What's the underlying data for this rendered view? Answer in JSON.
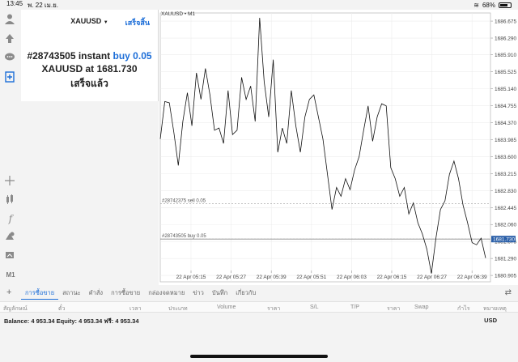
{
  "status_bar": {
    "time": "13:45",
    "date": "พ. 22 เม.ย.",
    "battery": "68%",
    "battery_level": 0.68
  },
  "dialog": {
    "symbol": "XAUUSD",
    "done_label": "เสร็จสิ้น",
    "order_prefix": "#28743505 instant",
    "order_action": "buy 0.05",
    "price_line": "XAUUSD at 1681.730",
    "status": "เสร็จแล้ว"
  },
  "chart": {
    "title": "XAUUSD • M1",
    "order_labels": [
      "#28742375 sell 0.05",
      "#28743505 buy 0.05"
    ],
    "current_price_tag": "1681.730"
  },
  "chart_data": {
    "type": "line",
    "x_labels": [
      "22 Apr 05:15",
      "22 Apr 05:27",
      "22 Apr 05:39",
      "22 Apr 05:51",
      "22 Apr 06:03",
      "22 Apr 06:15",
      "22 Apr 06:27",
      "22 Apr 06:39"
    ],
    "y_ticks": [
      "1686.675",
      "1686.290",
      "1685.910",
      "1685.525",
      "1685.140",
      "1684.755",
      "1684.370",
      "1683.985",
      "1683.600",
      "1683.215",
      "1682.830",
      "1682.445",
      "1682.060",
      "1681.675",
      "1681.290",
      "1680.905"
    ],
    "ylim": [
      1680.76,
      1686.86
    ],
    "levels": [
      {
        "label": "#28742375 sell 0.05",
        "price": 1682.53,
        "style": "dashed"
      },
      {
        "label": "#28743505 buy 0.05",
        "price": 1681.73,
        "style": "dashed"
      }
    ],
    "current_price": 1681.73,
    "series": [
      {
        "values": [
          1684.0,
          1684.85,
          1684.82,
          1684.15,
          1683.4,
          1684.4,
          1685.05,
          1684.3,
          1685.5,
          1684.9,
          1685.6,
          1685.0,
          1684.2,
          1684.25,
          1683.9,
          1685.1,
          1684.1,
          1684.2,
          1685.4,
          1684.9,
          1685.2,
          1684.4,
          1686.75,
          1685.3,
          1684.5,
          1685.8,
          1683.7,
          1684.25,
          1683.9,
          1685.1,
          1684.3,
          1683.7,
          1684.5,
          1684.9,
          1685.0,
          1684.5,
          1684.0,
          1683.2,
          1682.4,
          1682.9,
          1682.7,
          1683.1,
          1682.85,
          1683.3,
          1683.6,
          1684.2,
          1684.75,
          1683.95,
          1684.5,
          1684.8,
          1684.75,
          1683.35,
          1683.1,
          1682.7,
          1682.9,
          1682.3,
          1682.55,
          1682.1,
          1681.85,
          1681.5,
          1680.95,
          1681.75,
          1682.4,
          1682.6,
          1683.2,
          1683.5,
          1683.1,
          1682.5,
          1682.1,
          1681.65,
          1681.6,
          1681.75,
          1681.3
        ]
      }
    ]
  },
  "tabs": [
    "การซื้อขาย",
    "สถานะ",
    "คำสั่ง",
    "การซื้อขาย",
    "กล่องจดหมาย",
    "ข่าว",
    "บันทึก",
    "เกี่ยวกับ"
  ],
  "columns": [
    "สัญลักษณ์",
    "ตั๋ว",
    "เวลา",
    "ประเภท",
    "Volume",
    "ราคา",
    "S/L",
    "T/P",
    "ราคา",
    "Swap",
    "กำไร",
    "หมายเหตุ"
  ],
  "balance": {
    "text": "Balance: 4 953.34  Equity: 4 953.34  ฟรี: 4 953.34",
    "currency": "USD"
  }
}
